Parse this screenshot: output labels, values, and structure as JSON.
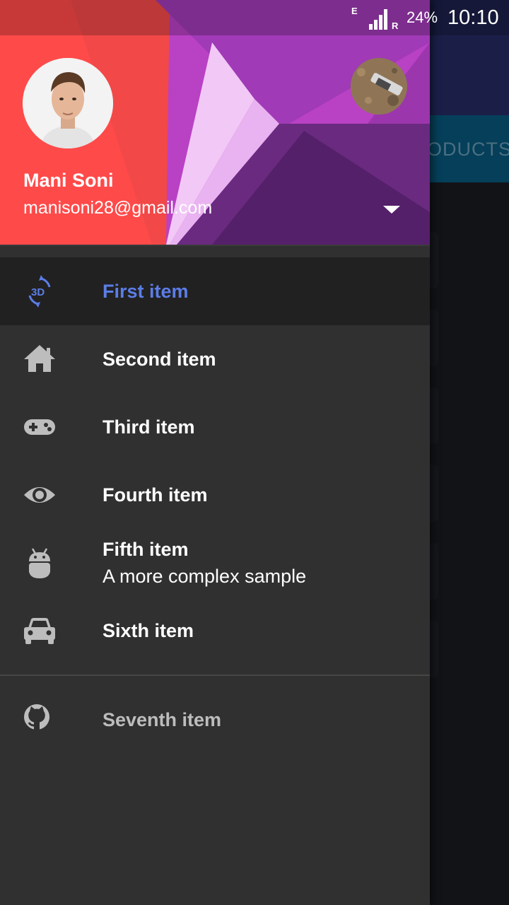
{
  "status_bar": {
    "network_type": "E",
    "roaming": "R",
    "battery": "24%",
    "time": "10:10"
  },
  "background_app": {
    "tab_label": "ODUCTS"
  },
  "drawer": {
    "profile": {
      "name": "Mani Soni",
      "email": "manisoni28@gmail.com"
    },
    "items": [
      {
        "label": "First item",
        "icon": "3d-rotation-icon",
        "selected": true
      },
      {
        "label": "Second item",
        "icon": "home-icon"
      },
      {
        "label": "Third item",
        "icon": "gamepad-icon"
      },
      {
        "label": "Fourth item",
        "icon": "eye-icon"
      },
      {
        "label": "Fifth item",
        "subtitle": "A more complex sample",
        "icon": "android-icon"
      },
      {
        "label": "Sixth item",
        "icon": "car-icon"
      }
    ],
    "secondary_items": [
      {
        "label": "Seventh item",
        "icon": "github-icon"
      }
    ]
  },
  "colors": {
    "accent": "#5b7de6",
    "drawer_bg": "#303030",
    "selected_bg": "#212121",
    "icon": "#bdbdbd"
  }
}
